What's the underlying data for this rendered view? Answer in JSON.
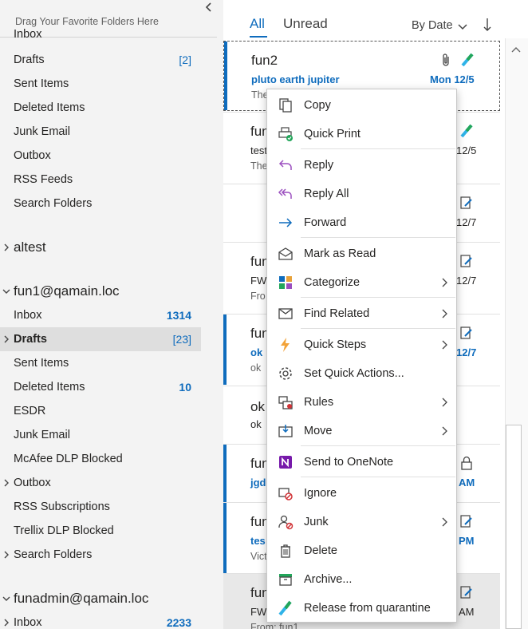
{
  "folder_pane": {
    "drag_hint": "Drag Your Favorite Folders Here",
    "partial_top": "Inbox",
    "group1": [
      {
        "name": "Drafts",
        "count": "[2]",
        "count_type": "draft"
      },
      {
        "name": "Sent Items",
        "count": ""
      },
      {
        "name": "Deleted Items",
        "count": ""
      },
      {
        "name": "Junk Email",
        "count": ""
      },
      {
        "name": "Outbox",
        "count": ""
      },
      {
        "name": "RSS Feeds",
        "count": ""
      },
      {
        "name": "Search Folders",
        "count": ""
      }
    ],
    "account_altest": "altest",
    "account_fun1": "fun1@qamain.loc",
    "group2": [
      {
        "name": "Inbox",
        "count": "1314",
        "count_type": "unread"
      },
      {
        "name": "Drafts",
        "count": "[23]",
        "count_type": "draft"
      },
      {
        "name": "Sent Items",
        "count": ""
      },
      {
        "name": "Deleted Items",
        "count": "10",
        "count_type": "unread"
      },
      {
        "name": "ESDR",
        "count": ""
      },
      {
        "name": "Junk Email",
        "count": ""
      },
      {
        "name": "McAfee DLP Blocked",
        "count": ""
      },
      {
        "name": "Outbox",
        "count": ""
      },
      {
        "name": "RSS Subscriptions",
        "count": ""
      },
      {
        "name": "Trellix DLP Blocked",
        "count": ""
      },
      {
        "name": "Search Folders",
        "count": ""
      }
    ],
    "account_funadmin": "funadmin@qamain.loc",
    "group3": [
      {
        "name": "Inbox",
        "count": "2233",
        "count_type": "unread"
      }
    ]
  },
  "message_list": {
    "tab_all": "All",
    "tab_unread": "Unread",
    "sort_label": "By Date",
    "messages": [
      {
        "sender": "fun2",
        "subject": "pluto earth jupiter",
        "preview": "The",
        "date": "Mon 12/5"
      },
      {
        "sender": "fun",
        "subject": "test",
        "preview": "The",
        "date": "12/5"
      },
      {
        "sender": "",
        "subject": "",
        "preview": "",
        "date": "12/7"
      },
      {
        "sender": "fun",
        "subject": "FW",
        "preview": "Fro",
        "date": "12/7"
      },
      {
        "sender": "fun",
        "subject": "ok",
        "preview": "ok",
        "date": "12/7"
      },
      {
        "sender": "ok",
        "subject": "ok",
        "preview": "",
        "date": ""
      },
      {
        "sender": "fun",
        "subject": "jgd",
        "preview": "",
        "date": "AM"
      },
      {
        "sender": "fun",
        "subject": "tes",
        "preview": "Vict",
        "date": "PM"
      },
      {
        "sender": "fun",
        "subject": "FW",
        "preview": "From: fun1",
        "date": "AM"
      }
    ]
  },
  "context_menu": {
    "copy": "Copy",
    "quick_print": "Quick Print",
    "reply": "Reply",
    "reply_all": "Reply All",
    "forward": "Forward",
    "mark_as_read": "Mark as Read",
    "categorize": "Categorize",
    "find_related": "Find Related",
    "quick_steps": "Quick Steps",
    "set_quick_actions": "Set Quick Actions...",
    "rules": "Rules",
    "move": "Move",
    "send_to_onenote": "Send to OneNote",
    "ignore": "Ignore",
    "junk": "Junk",
    "delete": "Delete",
    "archive": "Archive...",
    "release_from_quarantine": "Release from quarantine"
  },
  "colors": {
    "accent": "#0f6cbd",
    "unread_bar": "#0f6cbd",
    "folder_pane_bg": "#f3f3f3"
  }
}
